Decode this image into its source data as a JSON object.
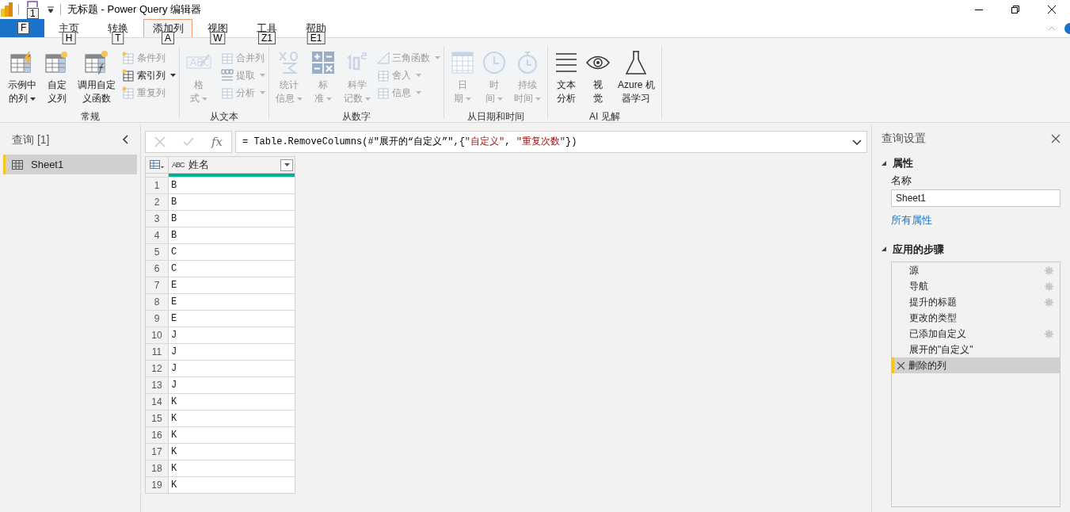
{
  "window": {
    "title": "无标题 - Power Query 编辑器",
    "quick_access_keytip": "1"
  },
  "file_tab": {
    "keytip": "F"
  },
  "tabs": [
    {
      "label": "主页",
      "keytip": "H",
      "selected": false
    },
    {
      "label": "转换",
      "keytip": "T",
      "selected": false
    },
    {
      "label": "添加列",
      "keytip": "A",
      "selected": true
    },
    {
      "label": "视图",
      "keytip": "W",
      "selected": false
    },
    {
      "label": "工具",
      "keytip": "Z1",
      "selected": false
    },
    {
      "label": "帮助",
      "keytip": "E1",
      "selected": false
    }
  ],
  "ribbon_groups": [
    {
      "label": "常规",
      "items": [
        {
          "kind": "large",
          "lines": [
            "示例中",
            "的列"
          ],
          "dropdown": true,
          "disabled": false
        },
        {
          "kind": "large",
          "lines": [
            "自定",
            "义列"
          ],
          "dropdown": false,
          "disabled": false
        },
        {
          "kind": "large",
          "lines": [
            "调用自定",
            "义函数"
          ],
          "dropdown": false,
          "disabled": false
        },
        {
          "kind": "small",
          "label": "条件列",
          "dropdown": false,
          "disabled": true
        },
        {
          "kind": "small",
          "label": "索引列",
          "dropdown": true,
          "disabled": false
        },
        {
          "kind": "small",
          "label": "重复列",
          "dropdown": false,
          "disabled": true
        }
      ]
    },
    {
      "label": "从文本",
      "items": [
        {
          "kind": "large",
          "lines": [
            "格",
            "式"
          ],
          "dropdown": true,
          "disabled": true
        },
        {
          "kind": "small",
          "label": "合并列",
          "dropdown": false,
          "disabled": true
        },
        {
          "kind": "small",
          "label": "提取",
          "dropdown": true,
          "disabled": true
        },
        {
          "kind": "small",
          "label": "分析",
          "dropdown": true,
          "disabled": true
        }
      ]
    },
    {
      "label": "从数字",
      "items": [
        {
          "kind": "large",
          "lines": [
            "统计",
            "信息"
          ],
          "dropdown": true,
          "disabled": true
        },
        {
          "kind": "large",
          "lines": [
            "标",
            "准"
          ],
          "dropdown": true,
          "disabled": true
        },
        {
          "kind": "large",
          "lines": [
            "科学",
            "记数"
          ],
          "dropdown": true,
          "disabled": true
        },
        {
          "kind": "small",
          "label": "三角函数",
          "dropdown": true,
          "disabled": true
        },
        {
          "kind": "small",
          "label": "舍入",
          "dropdown": true,
          "disabled": true
        },
        {
          "kind": "small",
          "label": "信息",
          "dropdown": true,
          "disabled": true
        }
      ]
    },
    {
      "label": "从日期和时间",
      "items": [
        {
          "kind": "large",
          "lines": [
            "日",
            "期"
          ],
          "dropdown": true,
          "disabled": true
        },
        {
          "kind": "large",
          "lines": [
            "时",
            "间"
          ],
          "dropdown": true,
          "disabled": true
        },
        {
          "kind": "large",
          "lines": [
            "持续",
            "时间"
          ],
          "dropdown": true,
          "disabled": true
        }
      ]
    },
    {
      "label": "AI 见解",
      "items": [
        {
          "kind": "large",
          "lines": [
            "文本",
            "分析"
          ],
          "dropdown": false,
          "disabled": false
        },
        {
          "kind": "large",
          "lines": [
            "视",
            "觉"
          ],
          "dropdown": false,
          "disabled": false
        },
        {
          "kind": "large",
          "lines": [
            "Azure 机",
            "器学习"
          ],
          "dropdown": false,
          "disabled": false
        }
      ]
    }
  ],
  "queries_panel": {
    "title": "查询 [1]",
    "items": [
      {
        "label": "Sheet1",
        "selected": true
      }
    ]
  },
  "formula_bar": {
    "fx": "fx",
    "segments": [
      {
        "kind": "plain",
        "text": "= Table.RemoveColumns(#\"展开的“自定义”\",{"
      },
      {
        "kind": "string",
        "text": "\"自定义\""
      },
      {
        "kind": "plain",
        "text": ", "
      },
      {
        "kind": "string",
        "text": "\"重复次数\""
      },
      {
        "kind": "plain",
        "text": "})"
      }
    ]
  },
  "table": {
    "columns": [
      {
        "type_label": "ABC",
        "name": "姓名"
      }
    ],
    "rows": [
      {
        "index": "1",
        "cells": [
          "B"
        ]
      },
      {
        "index": "2",
        "cells": [
          "B"
        ]
      },
      {
        "index": "3",
        "cells": [
          "B"
        ]
      },
      {
        "index": "4",
        "cells": [
          "B"
        ]
      },
      {
        "index": "5",
        "cells": [
          "C"
        ]
      },
      {
        "index": "6",
        "cells": [
          "C"
        ]
      },
      {
        "index": "7",
        "cells": [
          "E"
        ]
      },
      {
        "index": "8",
        "cells": [
          "E"
        ]
      },
      {
        "index": "9",
        "cells": [
          "E"
        ]
      },
      {
        "index": "10",
        "cells": [
          "J"
        ]
      },
      {
        "index": "11",
        "cells": [
          "J"
        ]
      },
      {
        "index": "12",
        "cells": [
          "J"
        ]
      },
      {
        "index": "13",
        "cells": [
          "J"
        ]
      },
      {
        "index": "14",
        "cells": [
          "K"
        ]
      },
      {
        "index": "15",
        "cells": [
          "K"
        ]
      },
      {
        "index": "16",
        "cells": [
          "K"
        ]
      },
      {
        "index": "17",
        "cells": [
          "K"
        ]
      },
      {
        "index": "18",
        "cells": [
          "K"
        ]
      },
      {
        "index": "19",
        "cells": [
          "K"
        ]
      }
    ]
  },
  "settings_panel": {
    "title": "查询设置",
    "properties": {
      "heading": "属性",
      "name_label": "名称",
      "name_value": "Sheet1",
      "all_properties_link": "所有属性"
    },
    "steps_heading": "应用的步骤",
    "steps": [
      {
        "label": "源",
        "has_settings": true,
        "selected": false
      },
      {
        "label": "导航",
        "has_settings": true,
        "selected": false
      },
      {
        "label": "提升的标题",
        "has_settings": true,
        "selected": false
      },
      {
        "label": "更改的类型",
        "has_settings": false,
        "selected": false
      },
      {
        "label": "已添加自定义",
        "has_settings": true,
        "selected": false
      },
      {
        "label": "展开的\"自定义\"",
        "has_settings": false,
        "selected": false
      },
      {
        "label": "删除的列",
        "has_settings": false,
        "selected": true
      }
    ]
  }
}
